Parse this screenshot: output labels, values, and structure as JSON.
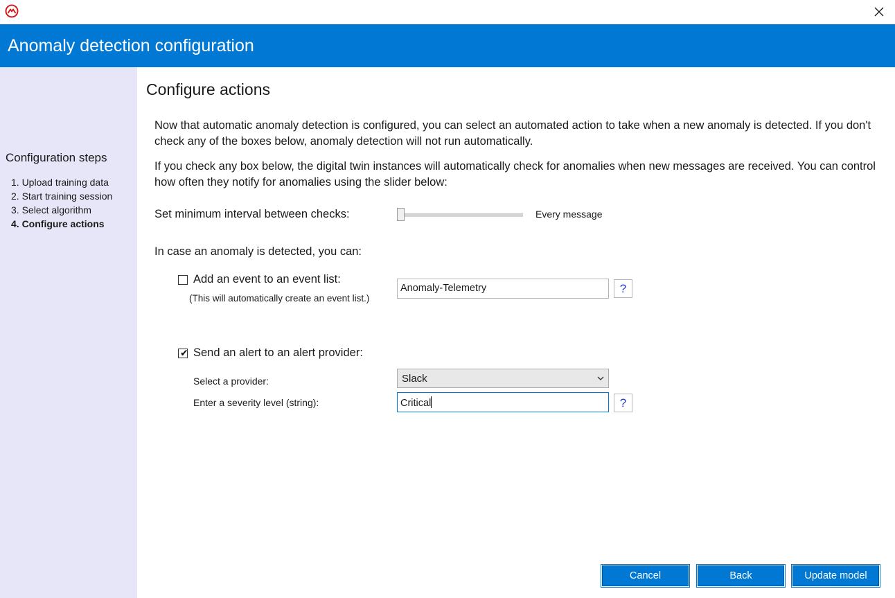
{
  "window": {
    "logo_icon": "mountain-circle-logo-icon",
    "close_icon": "close-icon"
  },
  "header": {
    "title": "Anomaly detection configuration",
    "accent_color": "#0078d4"
  },
  "sidebar": {
    "title": "Configuration steps",
    "items": [
      {
        "label": "1. Upload training data",
        "active": false
      },
      {
        "label": "2. Start training session",
        "active": false
      },
      {
        "label": "3. Select algorithm",
        "active": false
      },
      {
        "label": "4. Configure actions",
        "active": true
      }
    ],
    "background": "#e6e6f8"
  },
  "main": {
    "title": "Configure actions",
    "description1": "Now that automatic anomaly detection is configured, you can select an automated action to take when a new anomaly is detected. If you don't check any of the boxes below, anomaly detection will not run automatically.",
    "description2": "If you check any box below, the digital twin instances will automatically check for anomalies when new messages are received. You can control how often they notify for anomalies using the slider below:",
    "interval": {
      "label": "Set minimum interval between checks:",
      "value_label": "Every message",
      "slider_position": 0
    },
    "anomaly_label": "In case an anomaly is detected, you can:",
    "event_list": {
      "checked": false,
      "label": "Add an event to an event list:",
      "hint": "(This will automatically create an event list.)",
      "value": "Anomaly-Telemetry",
      "help": "?"
    },
    "alert": {
      "checked": true,
      "label": "Send an alert to an alert provider:",
      "provider_label": "Select a provider:",
      "provider_value": "Slack",
      "severity_label": "Enter a severity level (string):",
      "severity_value": "Critical",
      "help": "?"
    }
  },
  "footer": {
    "cancel": "Cancel",
    "back": "Back",
    "update": "Update model"
  }
}
